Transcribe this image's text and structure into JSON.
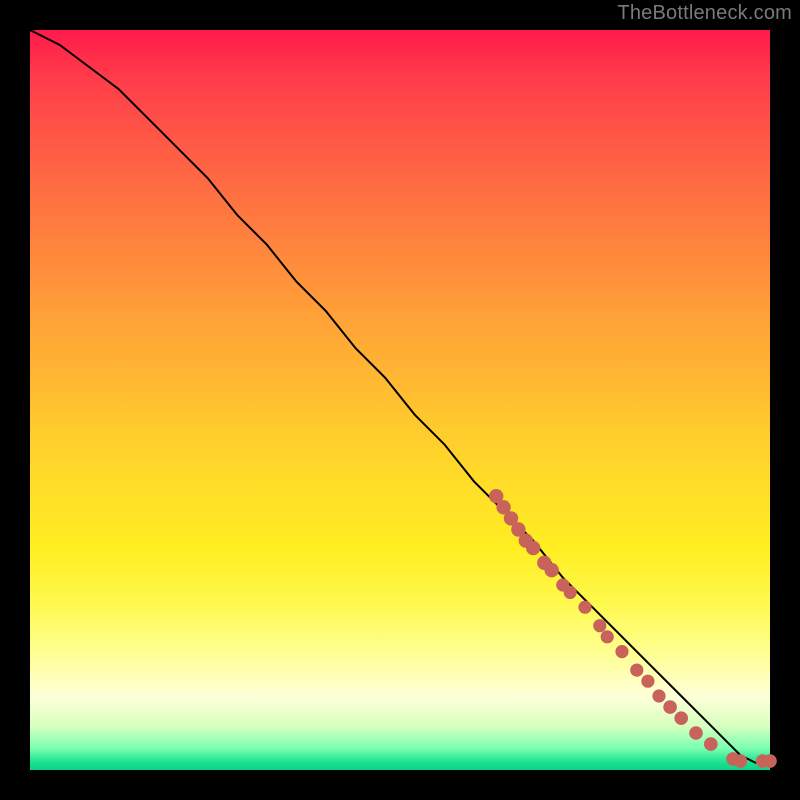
{
  "attribution": "TheBottleneck.com",
  "chart_data": {
    "type": "line",
    "title": "",
    "xlabel": "",
    "ylabel": "",
    "xlim": [
      0,
      100
    ],
    "ylim": [
      0,
      100
    ],
    "grid": false,
    "legend": null,
    "background": "heat-gradient",
    "series": [
      {
        "name": "bottleneck-curve",
        "x": [
          0,
          4,
          8,
          12,
          16,
          20,
          24,
          28,
          32,
          36,
          40,
          44,
          48,
          52,
          56,
          60,
          64,
          68,
          72,
          76,
          80,
          84,
          88,
          92,
          94,
          96,
          98,
          100
        ],
        "y": [
          100,
          98,
          95,
          92,
          88,
          84,
          80,
          75,
          71,
          66,
          62,
          57,
          53,
          48,
          44,
          39,
          35,
          31,
          26,
          22,
          18,
          14,
          10,
          6,
          4,
          2,
          1,
          1
        ]
      }
    ],
    "highlighted_cluster": {
      "description": "markers along the low-right tail of the curve",
      "points": [
        {
          "x": 63,
          "y": 37
        },
        {
          "x": 64,
          "y": 35.5
        },
        {
          "x": 65,
          "y": 34
        },
        {
          "x": 66,
          "y": 32.5
        },
        {
          "x": 67,
          "y": 31
        },
        {
          "x": 68,
          "y": 30
        },
        {
          "x": 69.5,
          "y": 28
        },
        {
          "x": 70.5,
          "y": 27
        },
        {
          "x": 72,
          "y": 25
        },
        {
          "x": 73,
          "y": 24
        },
        {
          "x": 75,
          "y": 22
        },
        {
          "x": 77,
          "y": 19.5
        },
        {
          "x": 78,
          "y": 18
        },
        {
          "x": 80,
          "y": 16
        },
        {
          "x": 82,
          "y": 13.5
        },
        {
          "x": 83.5,
          "y": 12
        },
        {
          "x": 85,
          "y": 10
        },
        {
          "x": 86.5,
          "y": 8.5
        },
        {
          "x": 88,
          "y": 7
        },
        {
          "x": 90,
          "y": 5
        },
        {
          "x": 92,
          "y": 3.5
        },
        {
          "x": 95,
          "y": 1.5
        },
        {
          "x": 96,
          "y": 1.2
        },
        {
          "x": 99,
          "y": 1.2
        },
        {
          "x": 100,
          "y": 1.2
        }
      ]
    }
  },
  "colors": {
    "marker": "#c7635b",
    "curve": "#000000",
    "frame": "#000000",
    "attribution_text": "#7a7a7a"
  }
}
